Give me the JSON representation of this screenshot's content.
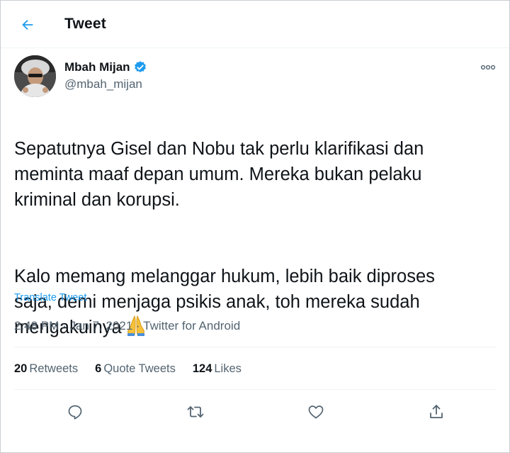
{
  "header": {
    "title": "Tweet"
  },
  "author": {
    "display_name": "Mbah Mijan",
    "handle": "@mbah_mijan",
    "verified": true
  },
  "tweet": {
    "paragraph_1": "Sepatutnya Gisel dan Nobu tak perlu klarifikasi dan\nmeminta maaf depan umum. Mereka bukan pelaku\nkriminal dan korupsi.",
    "paragraph_2": "Kalo memang melanggar hukum, lebih baik diproses\nsaja, demi menjaga psikis anak, toh mereka sudah\nmengakuinya",
    "emoji": "folded-hands-emoji",
    "translate_label": "Translate Tweet"
  },
  "meta": {
    "time": "2:48 PM",
    "separator": "·",
    "date": "Jan 7, 2021",
    "source": "Twitter for Android"
  },
  "stats": {
    "retweets_count": "20",
    "retweets_label": "Retweets",
    "quotes_count": "6",
    "quotes_label": "Quote Tweets",
    "likes_count": "124",
    "likes_label": "Likes"
  },
  "actions": {
    "reply": "reply-icon",
    "retweet": "retweet-icon",
    "like": "heart-icon",
    "share": "share-icon"
  },
  "colors": {
    "accent": "#1d9bf0",
    "text_primary": "#0f1419",
    "text_secondary": "#536471",
    "divider": "#eff3f4"
  }
}
